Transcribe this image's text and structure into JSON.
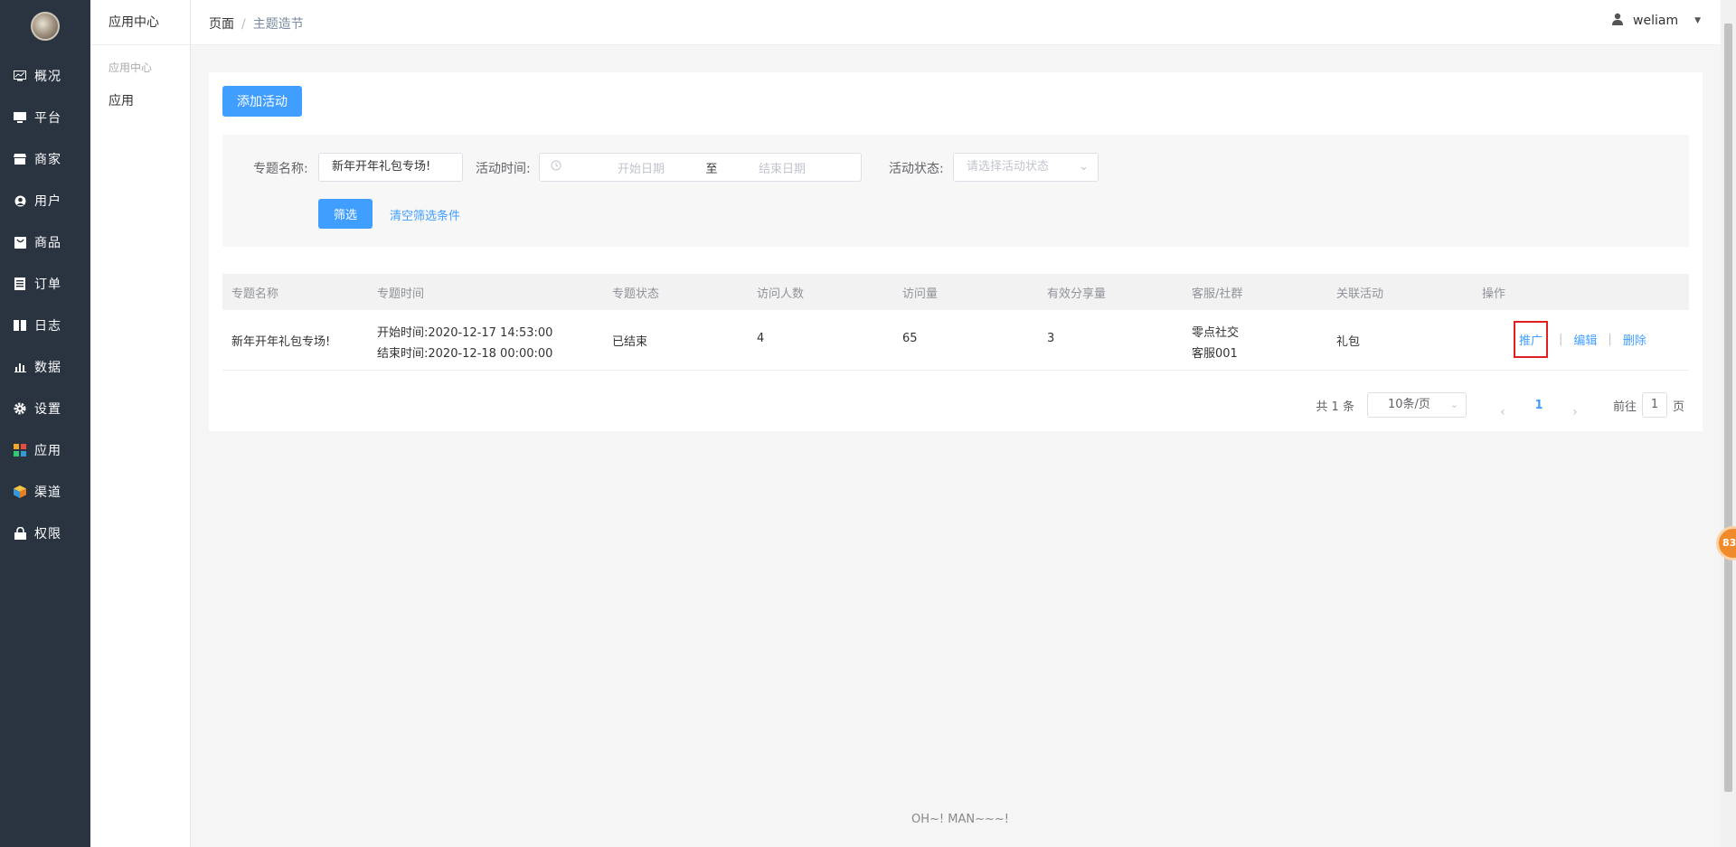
{
  "sidebar": {
    "items": [
      {
        "label": "概况",
        "icon": "dashboard-icon"
      },
      {
        "label": "平台",
        "icon": "monitor-icon"
      },
      {
        "label": "商家",
        "icon": "store-icon"
      },
      {
        "label": "用户",
        "icon": "user-icon"
      },
      {
        "label": "商品",
        "icon": "goods-icon"
      },
      {
        "label": "订单",
        "icon": "order-icon"
      },
      {
        "label": "日志",
        "icon": "log-icon"
      },
      {
        "label": "数据",
        "icon": "chart-icon"
      },
      {
        "label": "设置",
        "icon": "gear-icon"
      },
      {
        "label": "应用",
        "icon": "apps-icon"
      },
      {
        "label": "渠道",
        "icon": "cube-icon"
      },
      {
        "label": "权限",
        "icon": "lock-icon"
      }
    ]
  },
  "subside": {
    "header": "应用中心",
    "group": "应用中心",
    "item": "应用"
  },
  "topbar": {
    "crumb_root": "页面",
    "crumb_sep": "/",
    "crumb_current": "主题造节",
    "username": "weliam"
  },
  "toolbar": {
    "add_label": "添加活动"
  },
  "filter": {
    "name_label": "专题名称:",
    "name_value": "新年开年礼包专场!",
    "time_label": "活动时间:",
    "start_placeholder": "开始日期",
    "to_label": "至",
    "end_placeholder": "结束日期",
    "status_label": "活动状态:",
    "status_placeholder": "请选择活动状态",
    "submit_label": "筛选",
    "clear_label": "清空筛选条件"
  },
  "table": {
    "headers": [
      "专题名称",
      "专题时间",
      "专题状态",
      "访问人数",
      "访问量",
      "有效分享量",
      "客服/社群",
      "关联活动",
      "操作"
    ],
    "rows": [
      {
        "name": "新年开年礼包专场!",
        "start": "开始时间:2020-12-17 14:53:00",
        "end": "结束时间:2020-12-18 00:00:00",
        "status": "已结束",
        "visitors": "4",
        "views": "65",
        "shares": "3",
        "service_line1": "零点社交",
        "service_line2": "客服001",
        "activity": "礼包",
        "op_promote": "推广",
        "op_sep": "|",
        "op_edit": "编辑",
        "op_delete": "删除"
      }
    ]
  },
  "pagination": {
    "total": "共 1 条",
    "page_size": "10条/页",
    "current_page": "1",
    "goto_label": "前往",
    "goto_value": "1",
    "page_suffix": "页"
  },
  "fab": {
    "label": "83"
  },
  "footer": {
    "text": "OH~! MAN~~~!"
  },
  "colors": {
    "sidebar_bg": "#2a3340",
    "primary": "#409eff",
    "highlight": "#e02020"
  }
}
